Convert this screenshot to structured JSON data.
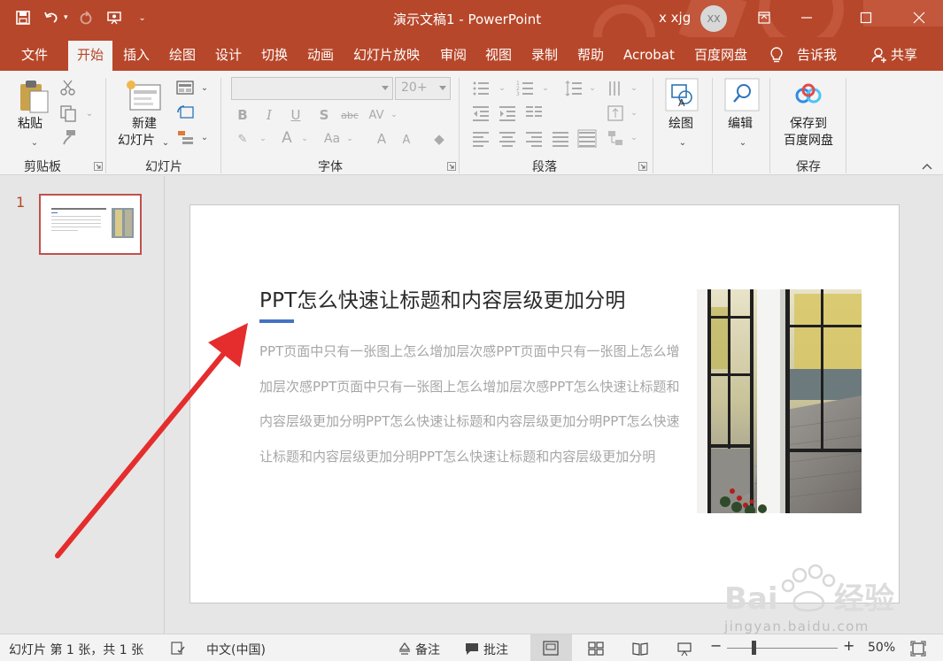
{
  "window": {
    "title": "演示文稿1  -  PowerPoint",
    "user": "x xjg",
    "avatar_initials": "XX"
  },
  "tabs": [
    "文件",
    "开始",
    "插入",
    "绘图",
    "设计",
    "切换",
    "动画",
    "幻灯片放映",
    "审阅",
    "视图",
    "录制",
    "帮助",
    "Acrobat",
    "百度网盘",
    "告诉我",
    "共享"
  ],
  "active_tab": "开始",
  "ribbon": {
    "clipboard": {
      "paste_label": "粘贴",
      "group_label": "剪贴板"
    },
    "slides": {
      "new_slide_line1": "新建",
      "new_slide_line2": "幻灯片",
      "group_label": "幻灯片"
    },
    "font": {
      "font_name": "",
      "font_size": "20+",
      "group_label": "字体"
    },
    "paragraph": {
      "group_label": "段落"
    },
    "drawing": {
      "label": "绘图"
    },
    "editing": {
      "label": "编辑"
    },
    "save": {
      "line1": "保存到",
      "line2": "百度网盘",
      "group_label": "保存"
    }
  },
  "slides_panel": {
    "slide_number": "1"
  },
  "slide": {
    "title": "PPT怎么快速让标题和内容层级更加分明",
    "body": "PPT页面中只有一张图上怎么增加层次感PPT页面中只有一张图上怎么增加层次感PPT页面中只有一张图上怎么增加层次感PPT怎么快速让标题和内容层级更加分明PPT怎么快速让标题和内容层级更加分明PPT怎么快速让标题和内容层级更加分明PPT怎么快速让标题和内容层级更加分明"
  },
  "statusbar": {
    "slide_info": "幻灯片 第 1 张，共 1 张",
    "language": "中文(中国)",
    "notes": "备注",
    "comments": "批注",
    "zoom": "50%"
  },
  "watermark": {
    "url": "jingyan.baidu.com"
  },
  "colors": {
    "accent": "#b7472a",
    "title_underline": "#4472c4",
    "arrow": "#e52d2d"
  }
}
